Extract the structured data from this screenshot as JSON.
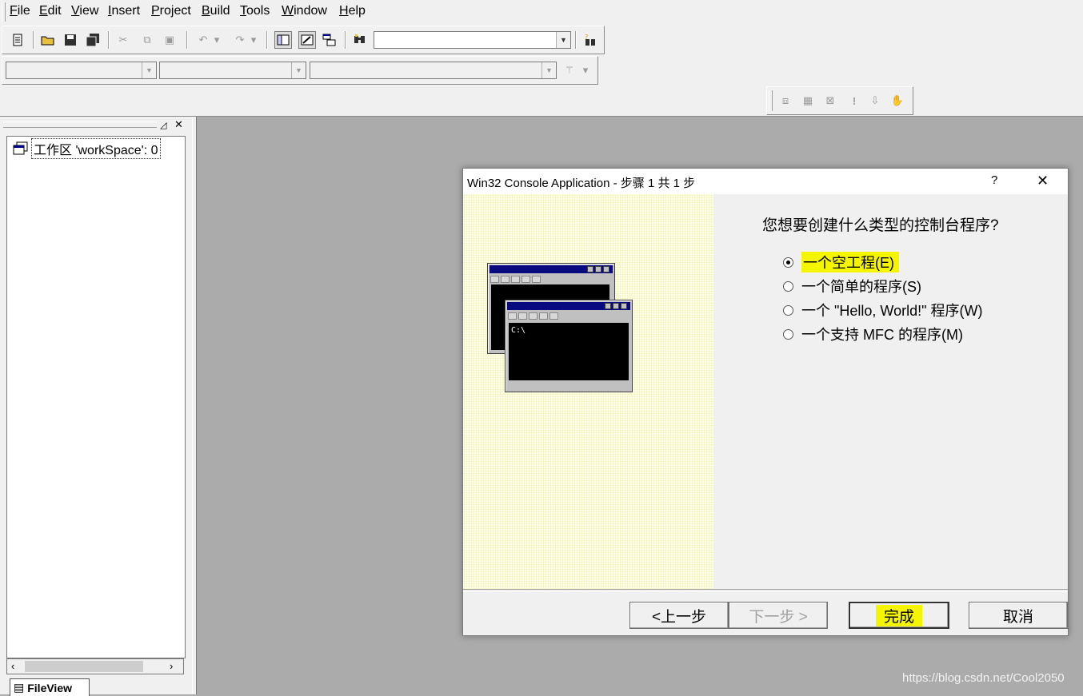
{
  "menubar": {
    "items": [
      "File",
      "Edit",
      "View",
      "Insert",
      "Project",
      "Build",
      "Tools",
      "Window",
      "Help"
    ]
  },
  "workspace": {
    "item_label": "工作区 'workSpace': 0",
    "tab_label": "FileView"
  },
  "dialog": {
    "title": "Win32 Console Application - 步骤 1 共 1 步",
    "help": "?",
    "close": "✕",
    "question": "您想要创建什么类型的控制台程序?",
    "options": [
      {
        "label": "一个空工程(E)",
        "selected": true
      },
      {
        "label": "一个简单的程序(S)",
        "selected": false
      },
      {
        "label": "一个 \"Hello, World!\" 程序(W)",
        "selected": false
      },
      {
        "label": "一个支持 MFC 的程序(M)",
        "selected": false
      }
    ],
    "buttons": {
      "back": "<上一步",
      "next": "下一步 >",
      "finish": "完成",
      "cancel": "取消"
    },
    "console_prompt": "C:\\"
  },
  "colors": {
    "highlight": "#f5f500",
    "titlebar": "#0a0a80"
  },
  "watermark": "https://blog.csdn.net/Cool2050"
}
